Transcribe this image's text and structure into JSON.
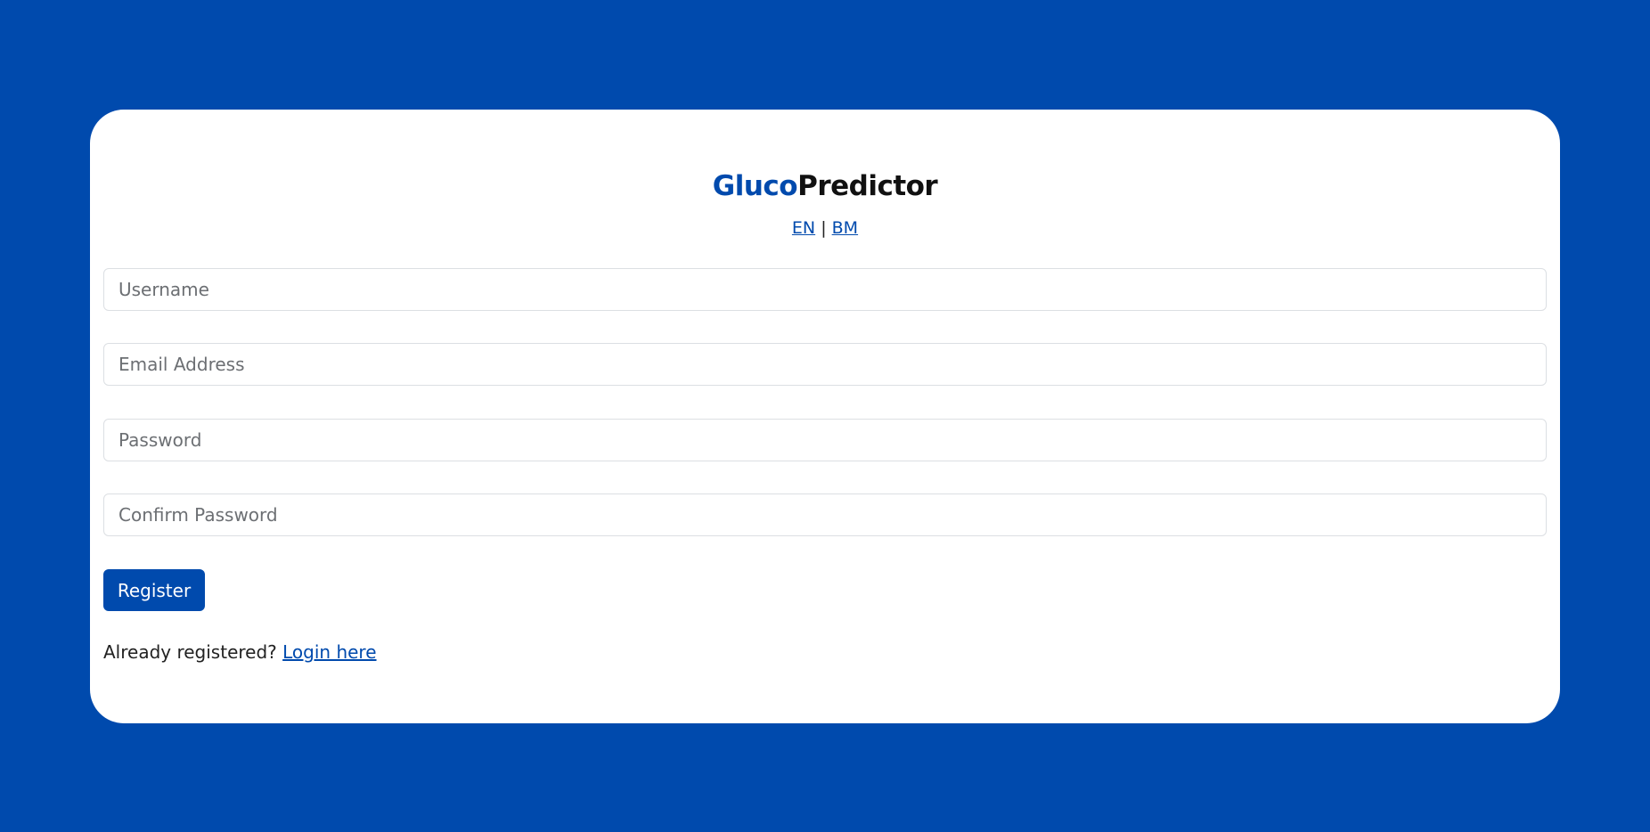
{
  "brand": {
    "part1": "Gluco",
    "part2": "Predictor",
    "color_primary": "#004aad"
  },
  "language": {
    "en": "EN",
    "separator": "|",
    "bm": "BM"
  },
  "form": {
    "username_placeholder": "Username",
    "email_placeholder": "Email Address",
    "password_placeholder": "Password",
    "confirm_password_placeholder": "Confirm Password",
    "register_label": "Register"
  },
  "footer": {
    "prompt": "Already registered?",
    "login_link": "Login here"
  },
  "colors": {
    "background": "#004aad",
    "card": "#ffffff",
    "button": "#004aad"
  }
}
